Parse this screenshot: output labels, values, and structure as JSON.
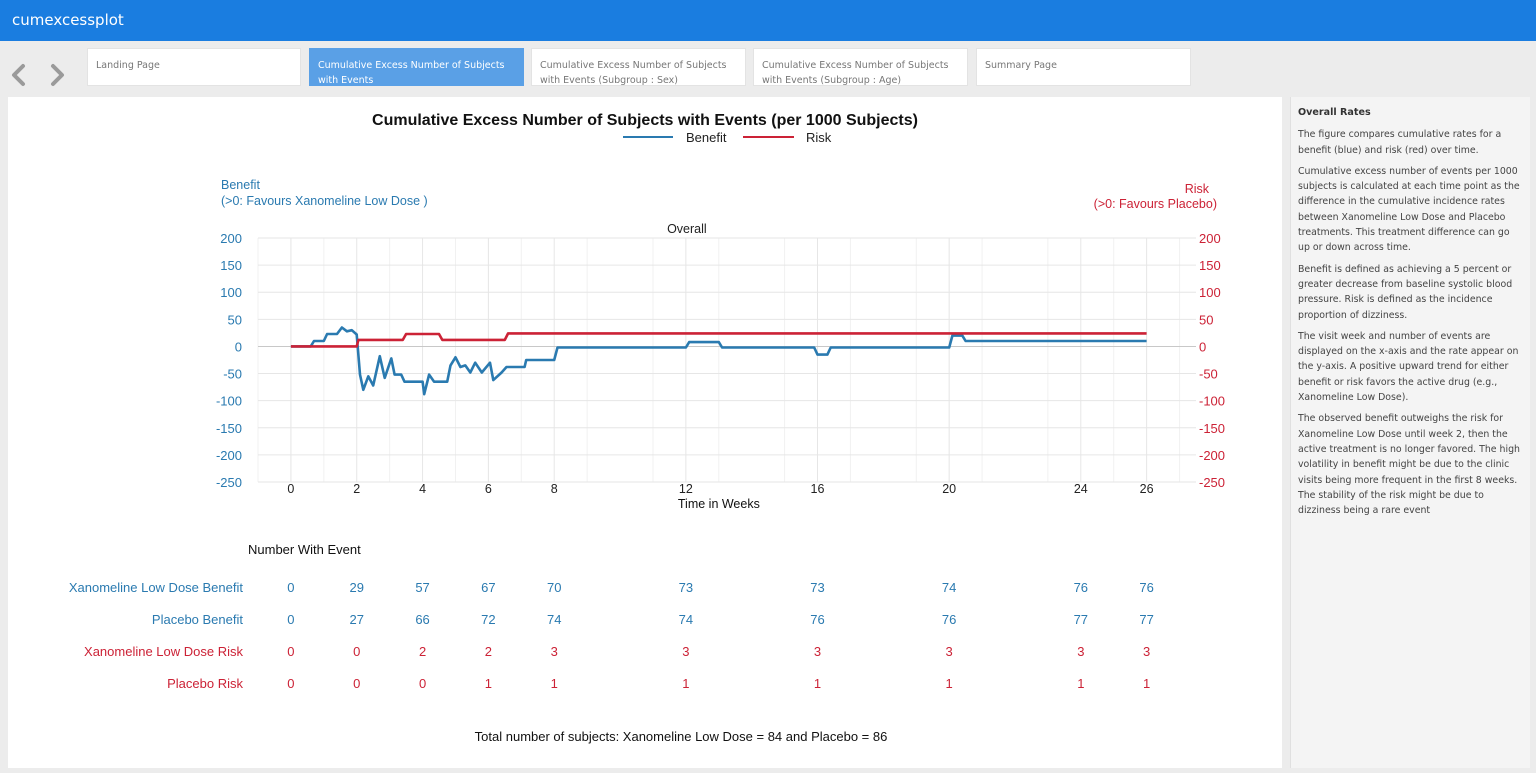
{
  "app": {
    "title": "cumexcessplot"
  },
  "nav": {
    "back_label": "‹",
    "forward_label": "›"
  },
  "tabs": [
    {
      "label": "Landing Page",
      "active": false
    },
    {
      "label": "Cumulative Excess Number of Subjects with Events",
      "active": true
    },
    {
      "label": "Cumulative Excess Number of Subjects with Events (Subgroup : Sex)",
      "active": false
    },
    {
      "label": "Cumulative Excess Number of Subjects with Events (Subgroup : Age)",
      "active": false
    },
    {
      "label": "Summary Page",
      "active": false
    }
  ],
  "colors": {
    "benefit": "#2a7ab0",
    "risk": "#cc2236",
    "topbar": "#1a7de0",
    "active_tab": "#5aa0e6"
  },
  "chart_data": {
    "type": "line",
    "title": "Cumulative Excess Number of Subjects with Events (per 1000 Subjects)",
    "subtitle": "Overall",
    "legend": [
      "Benefit",
      "Risk"
    ],
    "legend_position": "top",
    "left_axis_label": [
      "Benefit",
      "(>0: Favours Xanomeline Low Dose )"
    ],
    "right_axis_label": [
      "Risk",
      "(>0: Favours  Placebo)"
    ],
    "xlabel": "Time in Weeks",
    "x_ticks": [
      0,
      2,
      4,
      6,
      8,
      12,
      16,
      20,
      24,
      26
    ],
    "x_tick_labels": [
      "0",
      "2",
      "4",
      "6",
      "8",
      "12",
      "16",
      "20",
      "24",
      "26"
    ],
    "xlim": [
      -1,
      27.5
    ],
    "y_ticks": [
      200,
      150,
      100,
      50,
      0,
      -50,
      -100,
      -150,
      -200,
      -250
    ],
    "y_tick_labels": [
      "200",
      "150",
      "100",
      "50",
      "0",
      "-50",
      "-100",
      "-150",
      "-200",
      "-250"
    ],
    "ylim": [
      -250,
      200
    ],
    "grid": true,
    "series": [
      {
        "name": "Benefit",
        "points": [
          [
            0,
            0
          ],
          [
            0.6,
            0
          ],
          [
            0.7,
            10
          ],
          [
            1,
            10
          ],
          [
            1.1,
            23
          ],
          [
            1.4,
            23
          ],
          [
            1.55,
            35
          ],
          [
            1.7,
            28
          ],
          [
            1.85,
            30
          ],
          [
            2.0,
            22
          ],
          [
            2.1,
            -52
          ],
          [
            2.2,
            -80
          ],
          [
            2.35,
            -55
          ],
          [
            2.5,
            -72
          ],
          [
            2.7,
            -18
          ],
          [
            2.85,
            -58
          ],
          [
            3.05,
            -22
          ],
          [
            3.15,
            -52
          ],
          [
            3.35,
            -52
          ],
          [
            3.45,
            -65
          ],
          [
            4.0,
            -65
          ],
          [
            4.05,
            -88
          ],
          [
            4.2,
            -52
          ],
          [
            4.35,
            -65
          ],
          [
            4.75,
            -65
          ],
          [
            4.85,
            -35
          ],
          [
            5.0,
            -20
          ],
          [
            5.15,
            -38
          ],
          [
            5.3,
            -35
          ],
          [
            5.45,
            -48
          ],
          [
            5.6,
            -30
          ],
          [
            5.8,
            -48
          ],
          [
            6.05,
            -30
          ],
          [
            6.15,
            -62
          ],
          [
            6.4,
            -48
          ],
          [
            6.55,
            -38
          ],
          [
            7.1,
            -38
          ],
          [
            7.15,
            -25
          ],
          [
            8.0,
            -25
          ],
          [
            8.1,
            -2
          ],
          [
            12.0,
            -2
          ],
          [
            12.1,
            8
          ],
          [
            13.0,
            8
          ],
          [
            13.1,
            -2
          ],
          [
            15.9,
            -2
          ],
          [
            16.0,
            -15
          ],
          [
            16.3,
            -15
          ],
          [
            16.4,
            -2
          ],
          [
            20.0,
            -2
          ],
          [
            20.1,
            20
          ],
          [
            20.4,
            20
          ],
          [
            20.5,
            10
          ],
          [
            26,
            10
          ]
        ]
      },
      {
        "name": "Risk",
        "points": [
          [
            0,
            0
          ],
          [
            2.0,
            0
          ],
          [
            2.05,
            12
          ],
          [
            3.4,
            12
          ],
          [
            3.5,
            23
          ],
          [
            4.5,
            23
          ],
          [
            4.6,
            12
          ],
          [
            6.5,
            12
          ],
          [
            6.6,
            24
          ],
          [
            26,
            24
          ]
        ]
      }
    ],
    "table": {
      "heading": "Number With Event",
      "rows": [
        {
          "label": "Xanomeline Low Dose Benefit",
          "kind": "benefit",
          "values": [
            "0",
            "29",
            "57",
            "67",
            "70",
            "73",
            "73",
            "74",
            "76",
            "76"
          ]
        },
        {
          "label": "Placebo Benefit",
          "kind": "benefit",
          "values": [
            "0",
            "27",
            "66",
            "72",
            "74",
            "74",
            "76",
            "76",
            "77",
            "77"
          ]
        },
        {
          "label": "Xanomeline Low Dose Risk",
          "kind": "risk",
          "values": [
            "0",
            "0",
            "2",
            "2",
            "3",
            "3",
            "3",
            "3",
            "3",
            "3"
          ]
        },
        {
          "label": "Placebo Risk",
          "kind": "risk",
          "values": [
            "0",
            "0",
            "0",
            "1",
            "1",
            "1",
            "1",
            "1",
            "1",
            "1"
          ]
        }
      ]
    },
    "footnote": "Total number of subjects: Xanomeline Low Dose = 84 and Placebo = 86"
  },
  "sidebar": {
    "title": "Overall Rates",
    "paragraphs": [
      "The figure compares cumulative rates for a benefit (blue) and risk (red) over time.",
      "Cumulative excess number of events per 1000 subjects is calculated at each time point as the difference in the cumulative incidence rates between Xanomeline Low Dose and Placebo treatments. This treatment difference can go up or down across time.",
      "Benefit is defined as achieving a 5 percent or greater decrease from baseline systolic blood pressure. Risk is defined as the incidence proportion of dizziness.",
      "The visit week and number of events are displayed on the x-axis and the rate appear on the y-axis. A positive upward trend for either benefit or risk favors the active drug (e.g., Xanomeline Low Dose).",
      "The observed benefit outweighs the risk for Xanomeline Low Dose until week 2, then the active treatment is no longer favored. The high volatility in benefit might be due to the clinic visits being more frequent in the first 8 weeks. The stability of the risk might be due to dizziness being a rare event"
    ]
  }
}
